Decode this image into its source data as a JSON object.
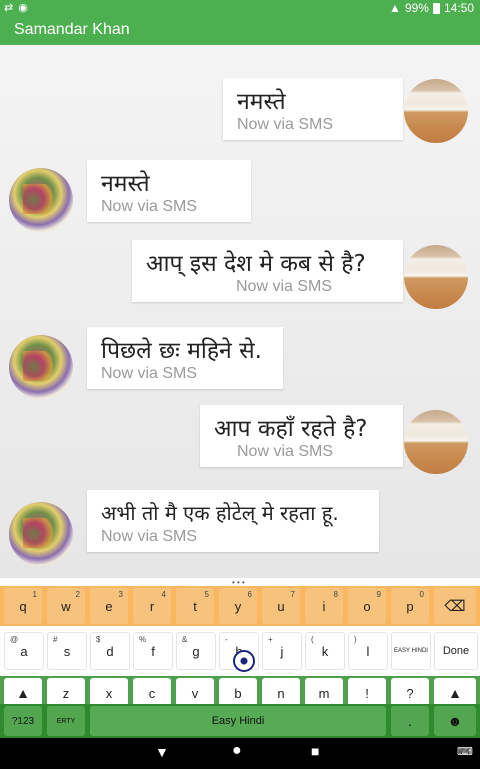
{
  "status_bar": {
    "battery": "99%",
    "time": "14:50"
  },
  "app_bar": {
    "title": "Samandar Khan"
  },
  "messages": [
    {
      "from": "me",
      "text": "नमस्ते",
      "meta": "Now via SMS"
    },
    {
      "from": "them",
      "text": "नमस्ते",
      "meta": "Now via SMS"
    },
    {
      "from": "me",
      "text": "आप् इस देश मे कब से है?",
      "meta": "Now via SMS"
    },
    {
      "from": "them",
      "text": "पिछले छः महिने से.",
      "meta": "Now via SMS"
    },
    {
      "from": "me",
      "text": "आप कहाँ रहते है?",
      "meta": "Now via SMS"
    },
    {
      "from": "them",
      "text": "अभी तो मै एक होटेल् मे रहता हू.",
      "meta": "Now via SMS"
    }
  ],
  "keyboard": {
    "row1": [
      {
        "k": "q",
        "h": "1"
      },
      {
        "k": "w",
        "h": "2"
      },
      {
        "k": "e",
        "h": "3"
      },
      {
        "k": "r",
        "h": "4"
      },
      {
        "k": "t",
        "h": "5"
      },
      {
        "k": "y",
        "h": "6"
      },
      {
        "k": "u",
        "h": "7"
      },
      {
        "k": "i",
        "h": "8"
      },
      {
        "k": "o",
        "h": "9"
      },
      {
        "k": "p",
        "h": "0"
      }
    ],
    "row2": [
      {
        "k": "a",
        "h": "@"
      },
      {
        "k": "s",
        "h": "#"
      },
      {
        "k": "d",
        "h": "$"
      },
      {
        "k": "f",
        "h": "%"
      },
      {
        "k": "g",
        "h": "&"
      },
      {
        "k": "h",
        "h": "-"
      },
      {
        "k": "j",
        "h": "+"
      },
      {
        "k": "k",
        "h": "("
      },
      {
        "k": "l",
        "h": ")"
      }
    ],
    "easy_key": "EASY HINDI",
    "done": "Done",
    "row3": [
      {
        "k": "z",
        "h": "*"
      },
      {
        "k": "x",
        "h": "\""
      },
      {
        "k": "c",
        "h": "'"
      },
      {
        "k": "v",
        "h": ":"
      },
      {
        "k": "b",
        "h": ";"
      },
      {
        "k": "n",
        "h": "!"
      },
      {
        "k": "m",
        "h": "?"
      },
      {
        "k": "!",
        "h": ""
      },
      {
        "k": "?",
        "h": ""
      }
    ],
    "symbols": "?123",
    "emoji_label": "ERTY",
    "space": "Easy Hindi",
    "period": "."
  },
  "colors": {
    "primary": "#4caf50",
    "saffron": "#f9b860",
    "green": "#2f8a2f"
  }
}
